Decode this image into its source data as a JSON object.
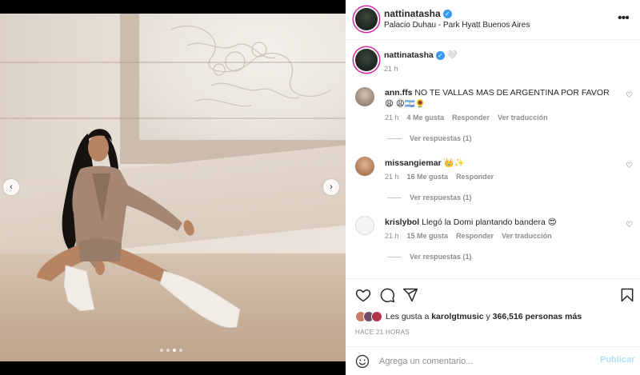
{
  "post": {
    "author": "nattinatasha",
    "location": "Palacio Duhau - Park Hyatt Buenos Aires",
    "caption_emoji": "🤍",
    "caption_time": "21 h"
  },
  "comments": [
    {
      "user": "ann.ffs",
      "text": "NO TE VALLAS MAS DE ARGENTINA POR FAVOR 😩 😩🇦🇷🌻",
      "time": "21 h",
      "likes": "4 Me gusta",
      "reply": "Responder",
      "translate": "Ver traducción",
      "view_replies": "Ver respuestas (1)"
    },
    {
      "user": "missangiemar",
      "text": "👑✨",
      "time": "21 h",
      "likes": "16 Me gusta",
      "reply": "Responder",
      "view_replies": "Ver respuestas (1)"
    },
    {
      "user": "krislybol",
      "text": "Llegó la Domi plantando bandera 😍",
      "time": "21 h",
      "likes": "15 Me gusta",
      "reply": "Responder",
      "translate": "Ver traducción",
      "view_replies": "Ver respuestas (1)"
    }
  ],
  "likes": {
    "prefix": "Les gusta a",
    "first_user": "karolgtmusic",
    "connector": "y",
    "others": "366,516 personas más"
  },
  "timestamp": "HACE 21 HORAS",
  "comment_input": {
    "placeholder": "Agrega un comentario...",
    "publish_label": "Publicar"
  },
  "carousel": {
    "prev_glyph": "‹",
    "next_glyph": "›",
    "dot_count": 4,
    "active_dot": 2
  },
  "colors": {
    "verified": "#3897f0",
    "publish_disabled": "#b2dffc",
    "muted_text": "#8e8e8e"
  },
  "icons": {
    "more": "more-options-icon",
    "heart": "heart-icon",
    "comment": "comment-icon",
    "share": "share-icon",
    "save": "bookmark-icon",
    "emoji": "smiley-icon"
  }
}
